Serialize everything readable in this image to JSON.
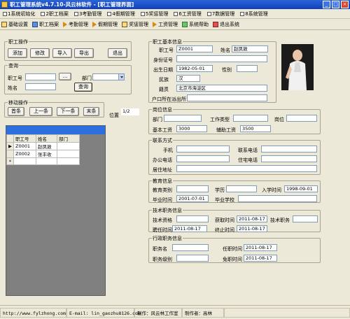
{
  "window": {
    "title": "职工管理系统v4.7.10-风云林软件 - [职工管理界面]"
  },
  "menu": {
    "items": [
      "1系统初始化",
      "2职工档案",
      "3考勤管理",
      "4假期管理",
      "5奖惩管理",
      "6工资管理",
      "7数据管理",
      "8系统管理"
    ]
  },
  "toolbar": {
    "items": [
      {
        "label": "基础设置",
        "icon": "settings-icon"
      },
      {
        "label": "职工档案",
        "icon": "folder-icon"
      },
      {
        "label": "考勤管理",
        "icon": "arrow-icon"
      },
      {
        "label": "假期管理",
        "icon": "arrow-icon"
      },
      {
        "label": "奖惩管理",
        "icon": "folder-icon"
      },
      {
        "label": "工资管理",
        "icon": "arrow-icon"
      },
      {
        "label": "系统帮助",
        "icon": "help-icon"
      },
      {
        "label": "退出系统",
        "icon": "exit-icon"
      }
    ]
  },
  "ops": {
    "title": "职工操作",
    "add": "添加",
    "edit": "修改",
    "import": "导入",
    "export": "导出",
    "exit": "退出"
  },
  "query": {
    "title": "查询",
    "emp_no_label": "职工号",
    "browse": "...",
    "dept_label": "部门",
    "name_label": "姓名",
    "query_btn": "查询"
  },
  "move": {
    "title": "移动操作",
    "first": "首条",
    "prev": "上一条",
    "next": "下一条",
    "last": "末条",
    "pos_label": "位置",
    "pos_value": "1/2"
  },
  "grid": {
    "headers": [
      "职工号",
      "姓名",
      "部门"
    ],
    "rows": [
      {
        "marker": "▶",
        "cells": [
          "Z0001",
          "赵凤敦",
          ""
        ]
      },
      {
        "marker": "",
        "cells": [
          "Z0002",
          "张丰收",
          ""
        ]
      },
      {
        "marker": "*",
        "cells": [
          "",
          "",
          ""
        ]
      }
    ]
  },
  "basic": {
    "title": "职工基本信息",
    "emp_no_label": "职工号",
    "emp_no": "Z0001",
    "name_label": "姓名",
    "name": "赵凤敦",
    "id_label": "身份证号",
    "id": "",
    "birth_label": "出生日期",
    "birth": "1982-05-01",
    "gender_label": "性别",
    "gender": "",
    "ethnic_label": "民族",
    "ethnic": "汉",
    "origin_label": "籍贯",
    "origin": "北京市海淀区",
    "hukou_label": "户口所在派出所",
    "hukou": ""
  },
  "job": {
    "title": "岗位信息",
    "dept_label": "部门",
    "dept": "",
    "type_label": "工作类型",
    "type": "",
    "post_label": "岗位",
    "post": "",
    "base_label": "基本工资",
    "base": "3000",
    "aux_label": "辅助工资",
    "aux": "3500"
  },
  "contact": {
    "title": "联系方式",
    "mobile_label": "手机",
    "mobile": "",
    "phone_label": "联系电话",
    "phone": "",
    "office_label": "办公电话",
    "office": "",
    "home_label": "住宅电话",
    "home": "",
    "addr_label": "居住地址",
    "addr": ""
  },
  "edu": {
    "title": "教育信息",
    "cat_label": "教育类别",
    "cat": "",
    "degree_label": "学历",
    "degree": "",
    "enroll_label": "入学时间",
    "enroll": "1998-09-01",
    "grad_label": "毕业时间",
    "grad": "2001-07-01",
    "school_label": "毕业学校",
    "school": ""
  },
  "tech": {
    "title": "技术职务信息",
    "qual_label": "技术资格",
    "qual": "",
    "get_label": "获取时间",
    "get": "2011-08-17",
    "duty_label": "技术职务",
    "duty": "",
    "hire_label": "聘任时间",
    "hire": "2011-08-17",
    "end_label": "终止时间",
    "end": "2011-08-17"
  },
  "admin": {
    "title": "行政职务信息",
    "name_label": "职务名",
    "name": "",
    "appoint_label": "任职时间",
    "appoint": "2011-08-17",
    "level_label": "职务级别",
    "level": "",
    "dismiss_label": "免职时间",
    "dismiss": "2011-08-17"
  },
  "status": {
    "url": "http://www.fylzhong.com",
    "email": "E-mail: lin_gaozhu8126.com",
    "maker": "制作：风云林工作室",
    "author": "制作者：高林"
  },
  "colors": {
    "titlebar": "#1c50c8",
    "grid_header": "#2c6fe0",
    "grid_bg": "#808080"
  }
}
